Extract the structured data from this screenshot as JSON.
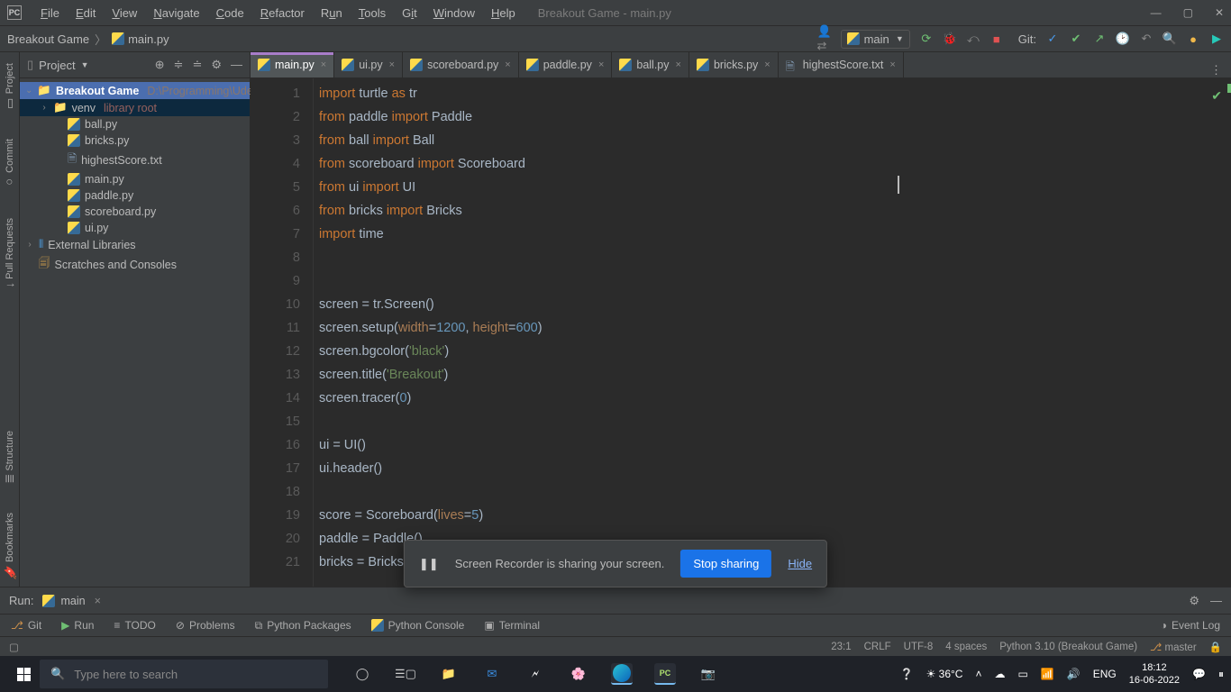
{
  "menu": {
    "file": "File",
    "edit": "Edit",
    "view": "View",
    "navigate": "Navigate",
    "code": "Code",
    "refactor": "Refactor",
    "run": "Run",
    "tools": "Tools",
    "git": "Git",
    "window": "Window",
    "help": "Help"
  },
  "title_doc": "Breakout Game - main.py",
  "breadcrumb": {
    "project": "Breakout Game",
    "file": "main.py"
  },
  "run_config": "main",
  "git_label": "Git:",
  "project_panel": {
    "title": "Project",
    "root": {
      "name": "Breakout Game",
      "path": "D:\\Programming\\Ude"
    },
    "venv": {
      "name": "venv",
      "hint": "library root"
    },
    "files": [
      "ball.py",
      "bricks.py",
      "highestScore.txt",
      "main.py",
      "paddle.py",
      "scoreboard.py",
      "ui.py"
    ],
    "ext_lib": "External Libraries",
    "scratches": "Scratches and Consoles"
  },
  "tabs": [
    {
      "name": "main.py",
      "type": "py",
      "active": true
    },
    {
      "name": "ui.py",
      "type": "py"
    },
    {
      "name": "scoreboard.py",
      "type": "py"
    },
    {
      "name": "paddle.py",
      "type": "py"
    },
    {
      "name": "ball.py",
      "type": "py"
    },
    {
      "name": "bricks.py",
      "type": "py"
    },
    {
      "name": "highestScore.txt",
      "type": "txt"
    }
  ],
  "code": {
    "lines": [
      [
        [
          "kw",
          "import"
        ],
        [
          "par",
          " turtle "
        ],
        [
          "kw",
          "as"
        ],
        [
          "par",
          " tr"
        ]
      ],
      [
        [
          "kw",
          "from"
        ],
        [
          "par",
          " paddle "
        ],
        [
          "kw",
          "import"
        ],
        [
          "par",
          " Paddle"
        ]
      ],
      [
        [
          "kw",
          "from"
        ],
        [
          "par",
          " ball "
        ],
        [
          "kw",
          "import"
        ],
        [
          "par",
          " Ball"
        ]
      ],
      [
        [
          "kw",
          "from"
        ],
        [
          "par",
          " scoreboard "
        ],
        [
          "kw",
          "import"
        ],
        [
          "par",
          " Scoreboard"
        ]
      ],
      [
        [
          "kw",
          "from"
        ],
        [
          "par",
          " ui "
        ],
        [
          "kw",
          "import"
        ],
        [
          "par",
          " UI"
        ]
      ],
      [
        [
          "kw",
          "from"
        ],
        [
          "par",
          " bricks "
        ],
        [
          "kw",
          "import"
        ],
        [
          "par",
          " Bricks"
        ]
      ],
      [
        [
          "kw",
          "import"
        ],
        [
          "par",
          " time"
        ]
      ],
      [],
      [],
      [
        [
          "par",
          "screen = tr.Screen()"
        ]
      ],
      [
        [
          "par",
          "screen.setup("
        ],
        [
          "prm",
          "width"
        ],
        [
          "par",
          "="
        ],
        [
          "num",
          "1200"
        ],
        [
          "par",
          ", "
        ],
        [
          "prm",
          "height"
        ],
        [
          "par",
          "="
        ],
        [
          "num",
          "600"
        ],
        [
          "par",
          ")"
        ]
      ],
      [
        [
          "par",
          "screen.bgcolor("
        ],
        [
          "str",
          "'black'"
        ],
        [
          "par",
          ")"
        ]
      ],
      [
        [
          "par",
          "screen.title("
        ],
        [
          "str",
          "'Breakout'"
        ],
        [
          "par",
          ")"
        ]
      ],
      [
        [
          "par",
          "screen.tracer("
        ],
        [
          "num",
          "0"
        ],
        [
          "par",
          ")"
        ]
      ],
      [],
      [
        [
          "par",
          "ui = UI()"
        ]
      ],
      [
        [
          "par",
          "ui.header()"
        ]
      ],
      [],
      [
        [
          "par",
          "score = Scoreboard("
        ],
        [
          "prm",
          "lives"
        ],
        [
          "par",
          "="
        ],
        [
          "num",
          "5"
        ],
        [
          "par",
          ")"
        ]
      ],
      [
        [
          "par",
          "paddle = Paddle()"
        ]
      ],
      [
        [
          "par",
          "bricks = Bricks()"
        ]
      ]
    ]
  },
  "share": {
    "msg": "Screen Recorder is sharing your screen.",
    "stop": "Stop sharing",
    "hide": "Hide"
  },
  "run_tool": {
    "label": "Run:",
    "tab": "main"
  },
  "bottom": {
    "git": "Git",
    "run": "Run",
    "todo": "TODO",
    "problems": "Problems",
    "pkg": "Python Packages",
    "console": "Python Console",
    "terminal": "Terminal",
    "eventlog": "Event Log"
  },
  "status": {
    "pos": "23:1",
    "le": "CRLF",
    "enc": "UTF-8",
    "indent": "4 spaces",
    "interp": "Python 3.10 (Breakout Game)",
    "branch": "master"
  },
  "leftrail": {
    "project": "Project",
    "commit": "Commit",
    "pull": "Pull Requests",
    "structure": "Structure",
    "bookmarks": "Bookmarks"
  },
  "taskbar": {
    "search_placeholder": "Type here to search",
    "temp": "36°C",
    "lang": "ENG",
    "time": "18:12",
    "date": "16-06-2022"
  }
}
